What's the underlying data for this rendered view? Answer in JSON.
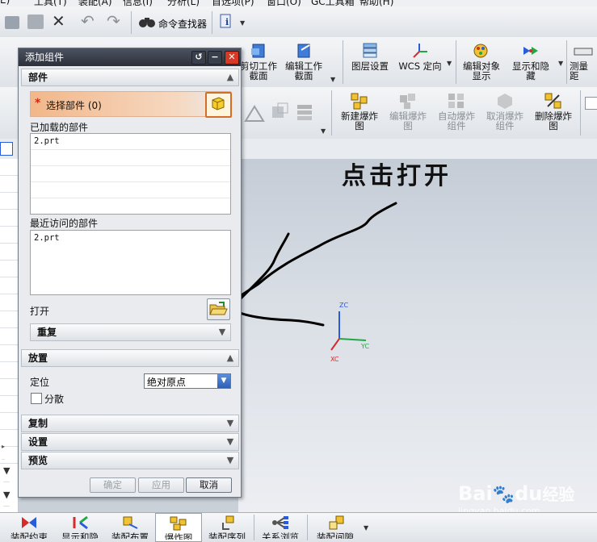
{
  "menu": [
    "E)",
    "工具(T)",
    "装配(A)",
    "信息(I)",
    "分析(L)",
    "首选项(P)",
    "窗口(O)",
    "GC工具箱",
    "帮助(H)"
  ],
  "toolbar1": {
    "command_finder": "命令查找器"
  },
  "toolbar2": [
    {
      "label1": "剪切工作",
      "label2": "截面",
      "name": "trim-work-section"
    },
    {
      "label1": "编辑工作",
      "label2": "截面",
      "name": "edit-work-section"
    },
    {
      "label1": "图层设置",
      "label2": "",
      "name": "layer-settings"
    },
    {
      "label1": "WCS 定向",
      "label2": "",
      "name": "wcs-orient"
    },
    {
      "label1": "编辑对象",
      "label2": "显示",
      "name": "edit-object-display"
    },
    {
      "label1": "显示和隐",
      "label2": "藏",
      "name": "show-hide"
    },
    {
      "label1": "测量距",
      "label2": "",
      "name": "measure-distance"
    }
  ],
  "toolbar3": [
    {
      "label1": "新建爆炸",
      "label2": "图",
      "enabled": true,
      "name": "new-explosion"
    },
    {
      "label1": "编辑爆炸",
      "label2": "图",
      "enabled": false,
      "name": "edit-explosion"
    },
    {
      "label1": "自动爆炸",
      "label2": "组件",
      "enabled": false,
      "name": "auto-explode"
    },
    {
      "label1": "取消爆炸",
      "label2": "组件",
      "enabled": false,
      "name": "unexplode"
    },
    {
      "label1": "删除爆炸",
      "label2": "图",
      "enabled": true,
      "name": "delete-explosion"
    }
  ],
  "dialog": {
    "title": "添加组件",
    "section_parts": "部件",
    "select_part": "选择部件 (0)",
    "loaded_parts_label": "已加载的部件",
    "loaded_parts": [
      "2.prt"
    ],
    "recent_parts_label": "最近访问的部件",
    "recent_parts": [
      "2.prt"
    ],
    "open_label": "打开",
    "repeat_label": "重复",
    "section_placement": "放置",
    "position_label": "定位",
    "position_value": "绝对原点",
    "scatter_label": "分散",
    "section_copy": "复制",
    "section_settings": "设置",
    "section_preview": "预览",
    "ok": "确定",
    "apply": "应用",
    "cancel": "取消"
  },
  "annotation": "点击打开",
  "axes": {
    "zc": "ZC",
    "yc": "YC",
    "xc": "XC"
  },
  "bottom_toolbar": [
    "装配约束",
    "显示和隐",
    "装配布置",
    "爆炸图",
    "装配序列",
    "关系浏览",
    "装配间隙"
  ],
  "watermark": {
    "brand": "Bai",
    "paw": "du",
    "site": "经验",
    "url": "jingyan.baidu.com"
  },
  "colors": {
    "accent_select": "#f2b78a",
    "annotation_ink": "#000000",
    "axis_z": "#2a5bd8",
    "axis_y": "#21a845",
    "axis_x": "#d82a2a"
  }
}
